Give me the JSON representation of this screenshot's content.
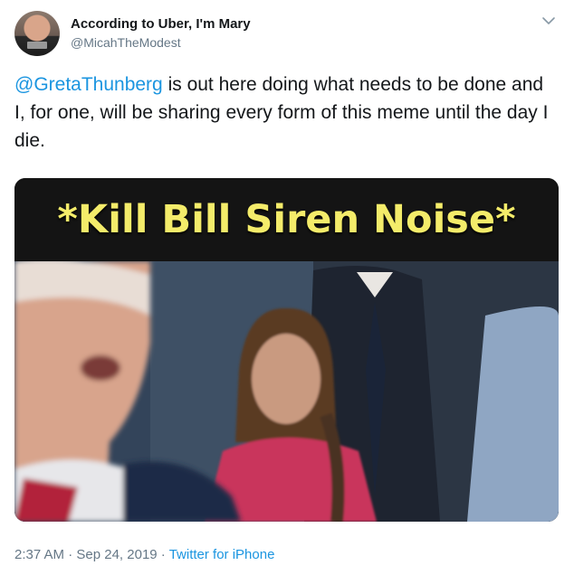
{
  "tweet": {
    "author": {
      "display_name": "According to Uber, I'm Mary",
      "handle": "@MicahTheModest"
    },
    "text": {
      "mention": "@GretaThunberg",
      "body": " is out here doing what needs to be done and I, for one, will be sharing every form of this meme until the day I die."
    },
    "media": {
      "caption": "*Kill Bill Siren Noise*"
    },
    "meta": {
      "time": "2:37 AM",
      "separator1": " · ",
      "date": "Sep 24, 2019",
      "separator2": " · ",
      "source": "Twitter for iPhone"
    },
    "icons": {
      "more": "chevron-down-icon"
    },
    "colors": {
      "link": "#1b95e0",
      "secondary": "#657786",
      "caption": "#f4ec6a"
    }
  }
}
